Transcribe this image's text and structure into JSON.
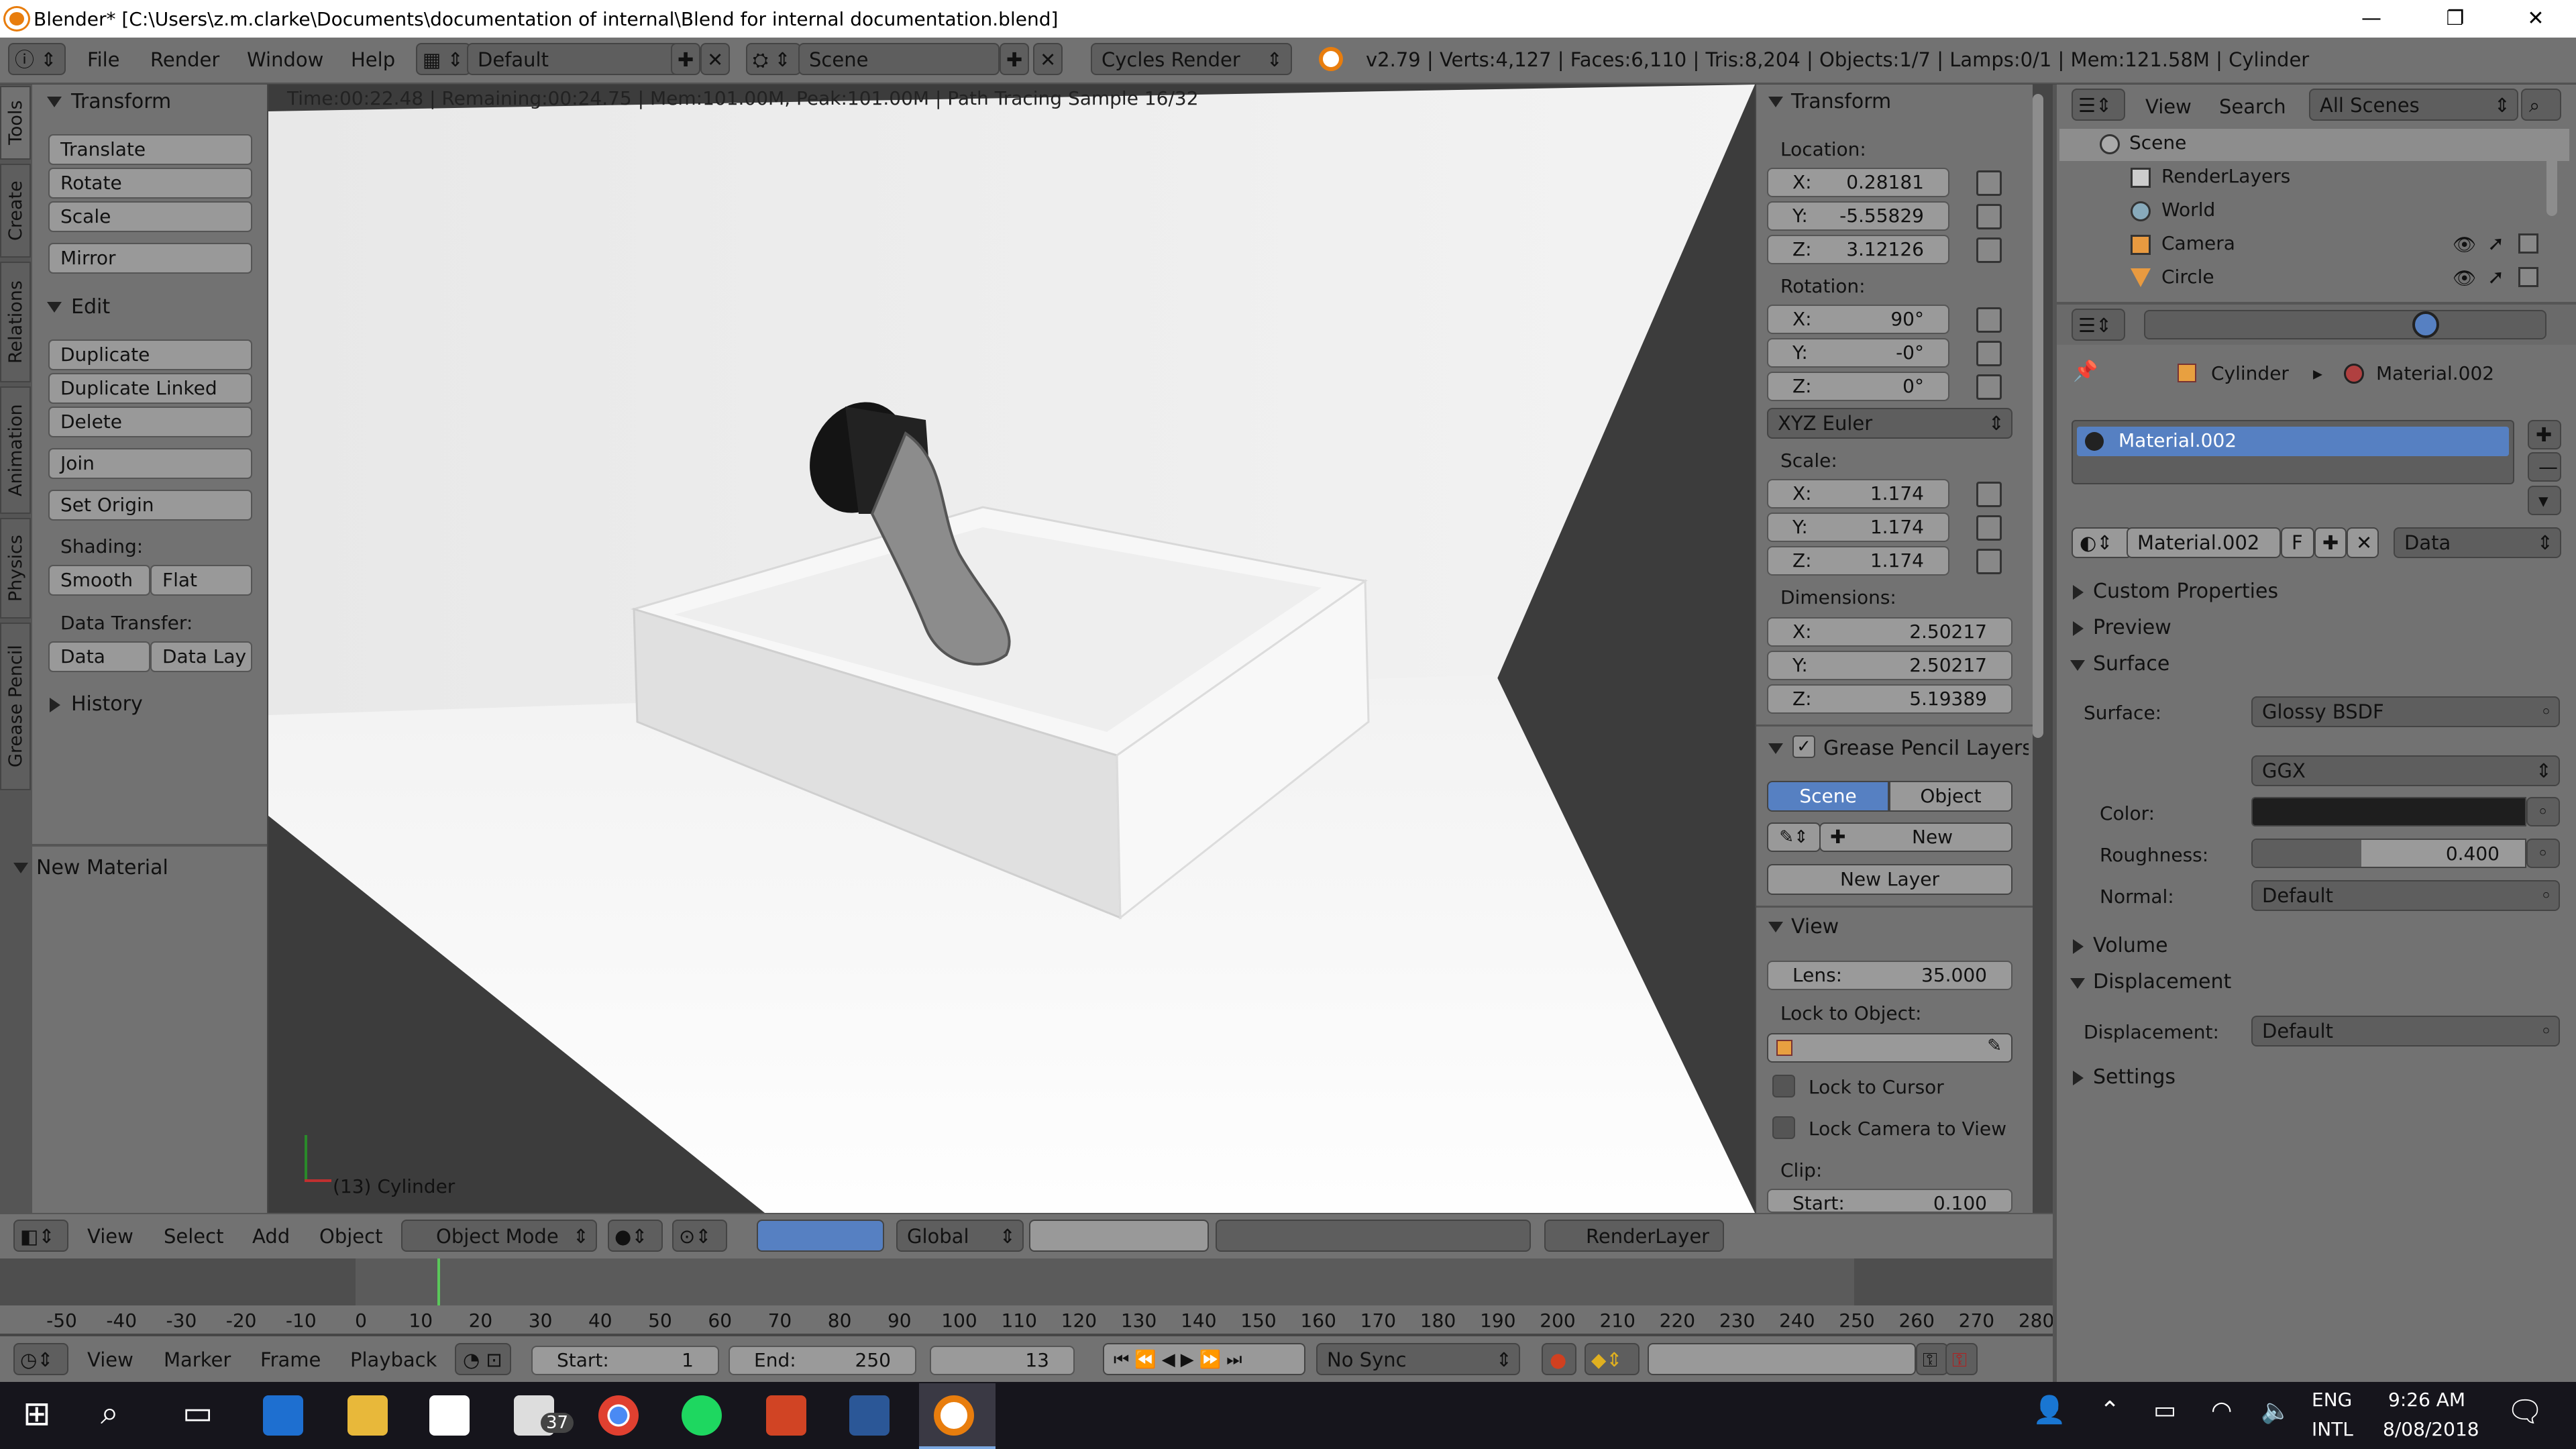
{
  "window": {
    "title": "Blender* [C:\\Users\\z.m.clarke\\Documents\\documentation of internal\\Blend for internal documentation.blend]",
    "min": "—",
    "max": "❐",
    "close": "✕"
  },
  "topmenu": {
    "file": "File",
    "render": "Render",
    "window": "Window",
    "help": "Help",
    "layout": "Default",
    "scene": "Scene",
    "engine": "Cycles Render",
    "stats": "v2.79 | Verts:4,127 | Faces:6,110 | Tris:8,204 | Objects:1/7 | Lamps:0/1 | Mem:121.58M | Cylinder"
  },
  "vtabs": [
    "Tools",
    "Create",
    "Relations",
    "Animation",
    "Physics",
    "Grease Pencil"
  ],
  "tools": {
    "transform_header": "Transform",
    "translate": "Translate",
    "rotate": "Rotate",
    "scale": "Scale",
    "mirror": "Mirror",
    "edit_header": "Edit",
    "duplicate": "Duplicate",
    "duplicate_linked": "Duplicate Linked",
    "delete": "Delete",
    "join": "Join",
    "set_origin": "Set Origin",
    "shading_label": "Shading:",
    "smooth": "Smooth",
    "flat": "Flat",
    "data_transfer_label": "Data Transfer:",
    "data": "Data",
    "data_lay": "Data Lay",
    "history": "History",
    "new_material": "New Material"
  },
  "viewport": {
    "render_info": "Time:00:22.48 | Remaining:00:24.75 | Mem:101.00M, Peak:101.00M | Path Tracing Sample 16/32",
    "object_label": "(13) Cylinder"
  },
  "props": {
    "transform_header": "Transform",
    "location": "Location:",
    "loc": [
      {
        "k": "X:",
        "v": "0.28181"
      },
      {
        "k": "Y:",
        "v": "-5.55829"
      },
      {
        "k": "Z:",
        "v": "3.12126"
      }
    ],
    "rotation": "Rotation:",
    "rot": [
      {
        "k": "X:",
        "v": "90°"
      },
      {
        "k": "Y:",
        "v": "-0°"
      },
      {
        "k": "Z:",
        "v": "0°"
      }
    ],
    "euler": "XYZ Euler",
    "scale": "Scale:",
    "scl": [
      {
        "k": "X:",
        "v": "1.174"
      },
      {
        "k": "Y:",
        "v": "1.174"
      },
      {
        "k": "Z:",
        "v": "1.174"
      }
    ],
    "dimensions": "Dimensions:",
    "dim": [
      {
        "k": "X:",
        "v": "2.50217"
      },
      {
        "k": "Y:",
        "v": "2.50217"
      },
      {
        "k": "Z:",
        "v": "5.19389"
      }
    ],
    "gp_layers": "Grease Pencil Layers",
    "gp_scene": "Scene",
    "gp_object": "Object",
    "gp_new": "New",
    "gp_new_layer": "New Layer",
    "view_header": "View",
    "lens_k": "Lens:",
    "lens_v": "35.000",
    "lock_to_object": "Lock to Object:",
    "lock_cursor": "Lock to Cursor",
    "lock_camera": "Lock Camera to View",
    "clip": "Clip:",
    "start_k": "Start:",
    "start_v": "0.100"
  },
  "outliner": {
    "view": "View",
    "search": "Search",
    "all_scenes": "All Scenes",
    "items": [
      "Scene",
      "RenderLayers",
      "World",
      "Camera",
      "Circle"
    ]
  },
  "material": {
    "crumb_obj": "Cylinder",
    "crumb_mat": "Material.002",
    "slot": "Material.002",
    "mat_name": "Material.002",
    "f": "F",
    "data": "Data",
    "custom_props": "Custom Properties",
    "preview": "Preview",
    "surface_header": "Surface",
    "surface_label": "Surface:",
    "surface_val": "Glossy BSDF",
    "dist": "GGX",
    "color_label": "Color:",
    "rough_label": "Roughness:",
    "rough_val": "0.400",
    "rough_fraction": 0.4,
    "normal_label": "Normal:",
    "normal_val": "Default",
    "volume": "Volume",
    "displacement_header": "Displacement",
    "displacement_label": "Displacement:",
    "displacement_val": "Default",
    "settings": "Settings"
  },
  "viewport_header": {
    "view": "View",
    "select": "Select",
    "add": "Add",
    "object": "Object",
    "mode": "Object Mode",
    "orientation": "Global",
    "renderlayer": "RenderLayer"
  },
  "timeline": {
    "ticks": [
      "-50",
      "-40",
      "-30",
      "-20",
      "-10",
      "0",
      "10",
      "20",
      "30",
      "40",
      "50",
      "60",
      "70",
      "80",
      "90",
      "100",
      "110",
      "120",
      "130",
      "140",
      "150",
      "160",
      "170",
      "180",
      "190",
      "200",
      "210",
      "220",
      "230",
      "240",
      "250",
      "260",
      "270",
      "280"
    ],
    "current_frame": 13,
    "view": "View",
    "marker": "Marker",
    "frame": "Frame",
    "playback": "Playback",
    "start_k": "Start:",
    "start_v": "1",
    "end_k": "End:",
    "end_v": "250",
    "cur": "13",
    "sync": "No Sync"
  },
  "taskbar": {
    "badge": "37",
    "lang1": "ENG",
    "lang2": "INTL",
    "time": "9:26 AM",
    "date": "8/08/2018"
  }
}
